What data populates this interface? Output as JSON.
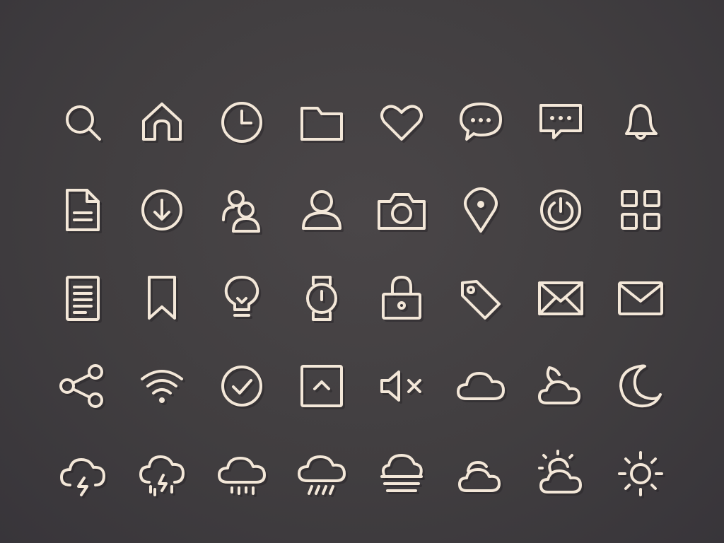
{
  "theme": {
    "background": "#433f42",
    "icon_color": "#f3e7d8",
    "shadow_color": "#2a2729"
  },
  "icons": [
    "search-icon",
    "home-icon",
    "clock-icon",
    "folder-icon",
    "heart-icon",
    "chat-bubble-icon",
    "message-icon",
    "bell-icon",
    "document-icon",
    "download-icon",
    "users-icon",
    "user-icon",
    "camera-icon",
    "location-pin-icon",
    "power-icon",
    "grid-icon",
    "list-document-icon",
    "bookmark-icon",
    "lightbulb-icon",
    "watch-icon",
    "lock-icon",
    "tag-icon",
    "mail-icon",
    "envelope-icon",
    "share-icon",
    "wifi-icon",
    "check-circle-icon",
    "expand-up-icon",
    "mute-icon",
    "cloud-icon",
    "cloud-moon-icon",
    "moon-icon",
    "thunderstorm-icon",
    "thunder-rain-icon",
    "rain-icon",
    "heavy-rain-icon",
    "fog-icon",
    "cloudy-icon",
    "partly-sunny-icon",
    "sun-icon"
  ]
}
